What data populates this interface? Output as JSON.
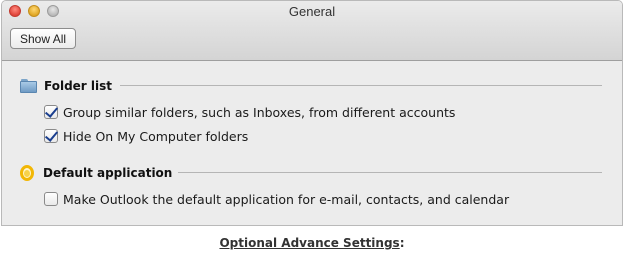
{
  "window": {
    "title": "General",
    "show_all_label": "Show All"
  },
  "sections": {
    "folder_list": {
      "label": "Folder list",
      "icon": "folder-icon",
      "options": [
        {
          "label": "Group similar folders, such as Inboxes, from different accounts",
          "checked": true
        },
        {
          "label": "Hide On My Computer folders",
          "checked": true
        }
      ]
    },
    "default_application": {
      "label": "Default application",
      "icon": "outlook-icon",
      "options": [
        {
          "label": "Make Outlook the default application for e-mail, contacts, and calendar",
          "checked": false
        }
      ]
    }
  },
  "caption": {
    "link_text": "Optional Advance Settings",
    "suffix": ":"
  },
  "colors": {
    "check_mark": "#1b3f8f",
    "folder_icon": "#6f9bc4",
    "outlook_icon": "#f2b705"
  }
}
